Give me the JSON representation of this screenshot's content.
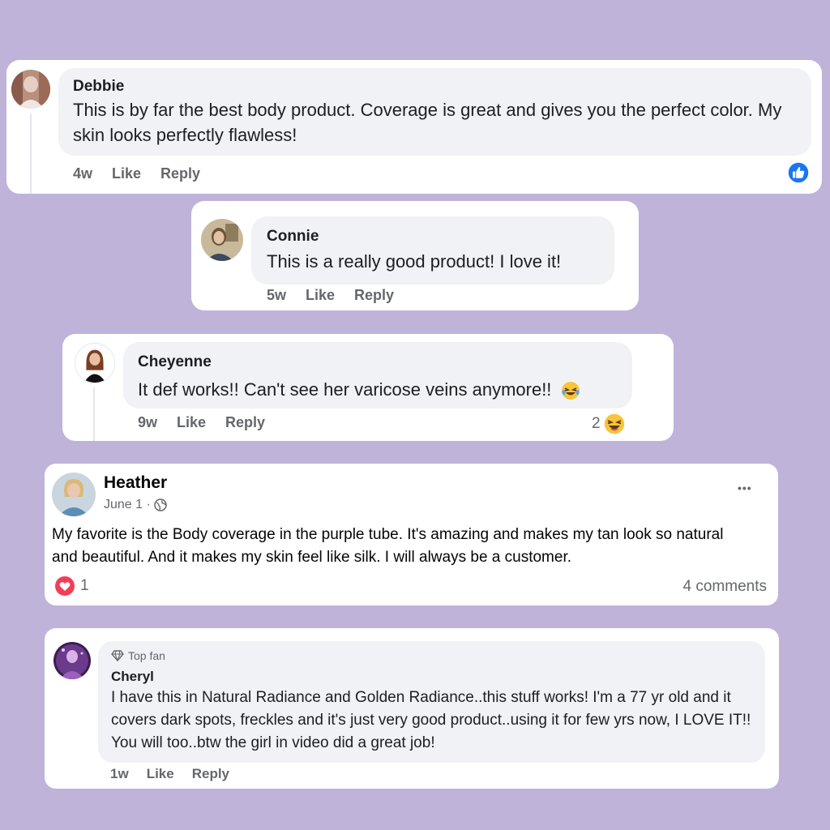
{
  "comments": [
    {
      "name": "Debbie",
      "text": "This is by far the best body product. Coverage is great and gives you the perfect color. My skin looks perfectly flawless!",
      "time": "4w",
      "like": "Like",
      "reply": "Reply"
    },
    {
      "name": "Connie",
      "text": "This is a really good product! I love it!",
      "time": "5w",
      "like": "Like",
      "reply": "Reply"
    },
    {
      "name": "Cheyenne",
      "text": "It def works!! Can't see her varicose veins anymore!!",
      "time": "9w",
      "like": "Like",
      "reply": "Reply",
      "reaction_count": "2"
    }
  ],
  "post": {
    "name": "Heather",
    "date": "June 1 ·",
    "text": "My favorite is the Body coverage in the purple tube. It's amazing and makes my tan look so natural and beautiful. And it makes my skin feel like silk. I will always be a customer.",
    "reaction_count": "1",
    "comments_count": "4 comments",
    "more": "•••"
  },
  "top_comment": {
    "badge": "Top fan",
    "name": "Cheryl",
    "text": "I have this in Natural Radiance and Golden Radiance..this stuff works! I'm a 77 yr old and it covers dark spots, freckles and it's just very good product..using it for few yrs now, I LOVE IT!! You will too..btw the girl in video did a great job!",
    "time": "1w",
    "like": "Like",
    "reply": "Reply"
  },
  "colors": {
    "background": "#c0b3da",
    "fb_blue": "#1877f2",
    "love_red": "#f33e58",
    "meta_gray": "#65676b",
    "bubble_gray": "#f0f2f5"
  },
  "icons": [
    "thumbs-up-icon",
    "laughing-emoji-icon",
    "heart-icon",
    "globe-icon",
    "diamond-icon",
    "more-icon"
  ]
}
